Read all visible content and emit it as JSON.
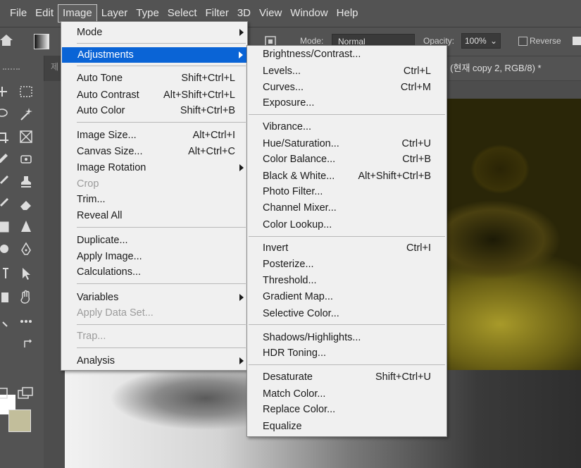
{
  "menubar": [
    "File",
    "Edit",
    "Image",
    "Layer",
    "Type",
    "Select",
    "Filter",
    "3D",
    "View",
    "Window",
    "Help"
  ],
  "options": {
    "mode_label": "Mode:",
    "mode_value": "Normal",
    "opacity_label": "Opacity:",
    "opacity_value": "100%",
    "reverse_label": "Reverse"
  },
  "tabs": {
    "left_fragment": "제",
    "active_doc": "% (현재 copy 2, RGB/8) *"
  },
  "image_menu": [
    {
      "label": "Mode",
      "shortcut": "",
      "submenu": true
    },
    {
      "label": "Adjustments",
      "shortcut": "",
      "submenu": true,
      "highlight": true
    },
    {
      "label": "Auto Tone",
      "shortcut": "Shift+Ctrl+L"
    },
    {
      "label": "Auto Contrast",
      "shortcut": "Alt+Shift+Ctrl+L"
    },
    {
      "label": "Auto Color",
      "shortcut": "Shift+Ctrl+B"
    },
    {
      "label": "Image Size...",
      "shortcut": "Alt+Ctrl+I"
    },
    {
      "label": "Canvas Size...",
      "shortcut": "Alt+Ctrl+C"
    },
    {
      "label": "Image Rotation",
      "shortcut": "",
      "submenu": true
    },
    {
      "label": "Crop",
      "shortcut": "",
      "disabled": true
    },
    {
      "label": "Trim...",
      "shortcut": ""
    },
    {
      "label": "Reveal All",
      "shortcut": ""
    },
    {
      "label": "Duplicate...",
      "shortcut": ""
    },
    {
      "label": "Apply Image...",
      "shortcut": ""
    },
    {
      "label": "Calculations...",
      "shortcut": ""
    },
    {
      "label": "Variables",
      "shortcut": "",
      "submenu": true
    },
    {
      "label": "Apply Data Set...",
      "shortcut": "",
      "disabled": true
    },
    {
      "label": "Trap...",
      "shortcut": "",
      "disabled": true
    },
    {
      "label": "Analysis",
      "shortcut": "",
      "submenu": true
    }
  ],
  "adjust_menu": [
    {
      "label": "Brightness/Contrast...",
      "shortcut": ""
    },
    {
      "label": "Levels...",
      "shortcut": "Ctrl+L"
    },
    {
      "label": "Curves...",
      "shortcut": "Ctrl+M"
    },
    {
      "label": "Exposure...",
      "shortcut": ""
    },
    {
      "label": "Vibrance...",
      "shortcut": ""
    },
    {
      "label": "Hue/Saturation...",
      "shortcut": "Ctrl+U"
    },
    {
      "label": "Color Balance...",
      "shortcut": "Ctrl+B"
    },
    {
      "label": "Black & White...",
      "shortcut": "Alt+Shift+Ctrl+B"
    },
    {
      "label": "Photo Filter...",
      "shortcut": ""
    },
    {
      "label": "Channel Mixer...",
      "shortcut": ""
    },
    {
      "label": "Color Lookup...",
      "shortcut": ""
    },
    {
      "label": "Invert",
      "shortcut": "Ctrl+I"
    },
    {
      "label": "Posterize...",
      "shortcut": ""
    },
    {
      "label": "Threshold...",
      "shortcut": ""
    },
    {
      "label": "Gradient Map...",
      "shortcut": ""
    },
    {
      "label": "Selective Color...",
      "shortcut": ""
    },
    {
      "label": "Shadows/Highlights...",
      "shortcut": ""
    },
    {
      "label": "HDR Toning...",
      "shortcut": ""
    },
    {
      "label": "Desaturate",
      "shortcut": "Shift+Ctrl+U"
    },
    {
      "label": "Match Color...",
      "shortcut": ""
    },
    {
      "label": "Replace Color...",
      "shortcut": ""
    },
    {
      "label": "Equalize",
      "shortcut": ""
    }
  ],
  "colors": {
    "menu_highlight": "#0a64d6",
    "foreground": "#ffffff",
    "background": "#c2be9b"
  },
  "icons": [
    "home-icon",
    "marquee-icon",
    "magic-wand-icon",
    "crop-icon",
    "frame-icon",
    "eyedropper-icon",
    "healing-icon",
    "stamp-icon",
    "brush-icon",
    "eraser-icon",
    "gradient-icon",
    "blur-icon",
    "pen-icon",
    "type-icon",
    "path-select-icon",
    "hand-icon",
    "more-icon",
    "swap-colors-icon",
    "screen-mode-icon"
  ]
}
